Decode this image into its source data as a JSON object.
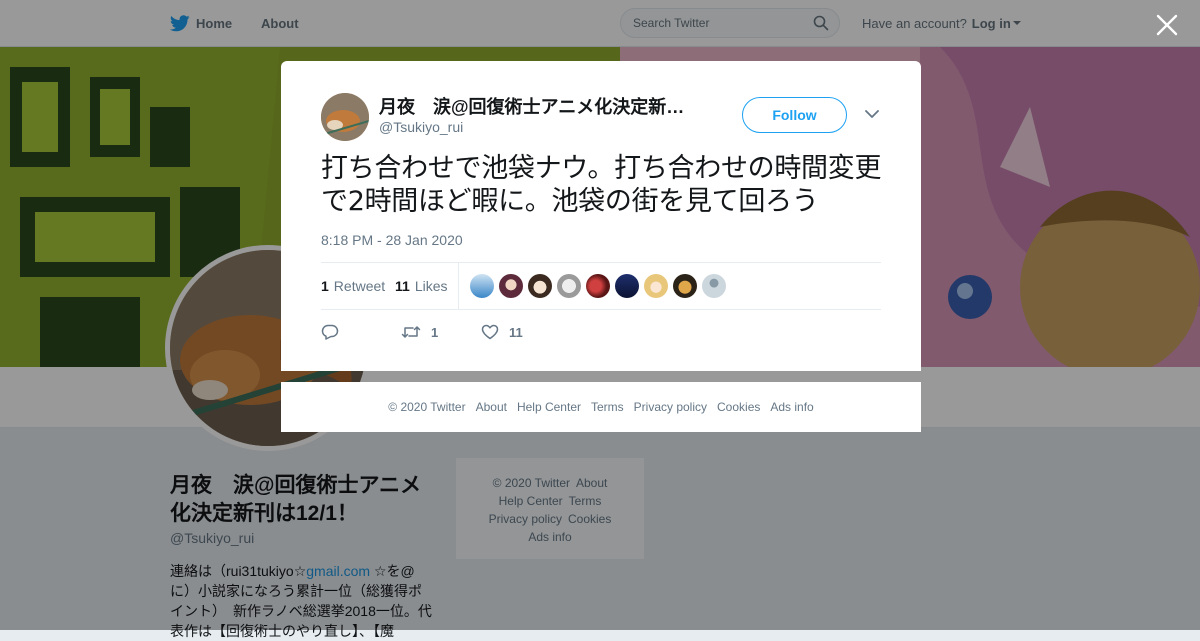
{
  "nav": {
    "home_label": "Home",
    "about_label": "About",
    "search_placeholder": "Search Twitter",
    "account_prompt": "Have an account?",
    "login_label": "Log in"
  },
  "profile": {
    "name": "月夜　涙@回復術士アニメ化決定新刊は12/1！",
    "handle": "@Tsukiyo_rui",
    "bio_prefix": "連絡は（rui31tukiyo☆",
    "bio_link": "gmail.com",
    "bio_rest": " ☆を@に）小説家になろう累計一位（総獲得ポイント）　新作ラノベ総選挙2018一位。代表作は【回復術士のやり直し】、【魔"
  },
  "side_footer": [
    "© 2020 Twitter",
    "About",
    "Help Center",
    "Terms",
    "Privacy policy",
    "Cookies",
    "Ads info"
  ],
  "tweet": {
    "author_name": "月夜　涙@回復術士アニメ化決定新刊は12/1！",
    "author_handle": "@Tsukiyo_rui",
    "follow_label": "Follow",
    "text": "打ち合わせで池袋ナウ。打ち合わせの時間変更で2時間ほど暇に。池袋の街を見て回ろう",
    "timestamp": "8:18 PM - 28 Jan 2020",
    "retweet_count": "1",
    "retweet_label": "Retweet",
    "like_count": "11",
    "like_label": "Likes",
    "reply_action_count": "",
    "retweet_action_count": "1",
    "like_action_count": "11"
  },
  "modal_footer": [
    "© 2020 Twitter",
    "About",
    "Help Center",
    "Terms",
    "Privacy policy",
    "Cookies",
    "Ads info"
  ],
  "colors": {
    "accent": "#1da1f2",
    "banner_green": "#9aa83a",
    "overlay": "rgba(0,0,0,0.4)"
  },
  "icons": [
    "twitter-bird-icon",
    "search-icon",
    "caret-down-icon",
    "close-icon",
    "chevron-down-icon",
    "reply-icon",
    "retweet-icon",
    "heart-icon"
  ]
}
